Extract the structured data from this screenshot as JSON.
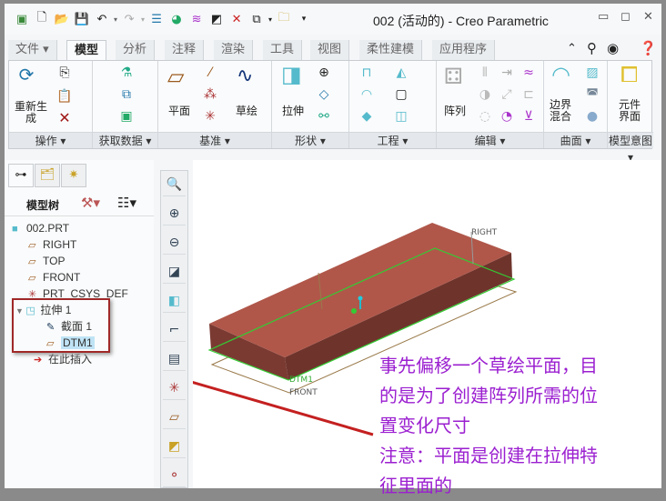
{
  "window": {
    "title": "002 (活动的) - Creo Parametric"
  },
  "quick_access": [
    "app-icon",
    "new-icon",
    "open-icon",
    "save-icon",
    "undo-icon",
    "redo-icon",
    "regenerate-icon",
    "shading-icon",
    "sketch-display-icon",
    "appearance-icon",
    "close-window-icon",
    "windows-icon",
    "folder-icon",
    "customize-icon"
  ],
  "tabs": [
    {
      "label": "文件 ▾"
    },
    {
      "label": "模型"
    },
    {
      "label": "分析"
    },
    {
      "label": "注释"
    },
    {
      "label": "渲染"
    },
    {
      "label": "工具"
    },
    {
      "label": "视图"
    },
    {
      "label": "柔性建模"
    },
    {
      "label": "应用程序"
    }
  ],
  "ribbon": {
    "groups": [
      {
        "label": "操作 ▾"
      },
      {
        "label": "获取数据 ▾"
      },
      {
        "label": "基准 ▾"
      },
      {
        "label": "形状 ▾"
      },
      {
        "label": "工程 ▾"
      },
      {
        "label": "编辑 ▾"
      },
      {
        "label": "曲面 ▾"
      },
      {
        "label": "模型意图 ▾"
      }
    ],
    "regenerate": "重新生成",
    "plane": "平面",
    "sketch": "草绘",
    "extrude": "拉伸",
    "pattern": "阵列",
    "boundary_blend": "边界混合",
    "component_interface": "元件界面"
  },
  "model_tree": {
    "title": "模型树",
    "items": [
      {
        "label": "002.PRT",
        "icon": "part-icon"
      },
      {
        "label": "RIGHT",
        "icon": "datum-plane-icon"
      },
      {
        "label": "TOP",
        "icon": "datum-plane-icon"
      },
      {
        "label": "FRONT",
        "icon": "datum-plane-icon"
      },
      {
        "label": "PRT_CSYS_DEF",
        "icon": "csys-icon"
      },
      {
        "label": "拉伸 1",
        "icon": "extrude-icon"
      },
      {
        "label": "截面 1",
        "icon": "sketch-icon"
      },
      {
        "label": "DTM1",
        "icon": "datum-plane-icon",
        "selected": true
      },
      {
        "label": "在此插入",
        "icon": "insert-arrow-icon"
      }
    ]
  },
  "view_toolbar": [
    "refit-icon",
    "zoom-in-icon",
    "zoom-out-icon",
    "repaint-icon",
    "display-style-icon",
    "saved-views-icon",
    "view-manager-icon",
    "spin-center-icon",
    "datum-planes-display-icon",
    "annotation-display-icon",
    "csys-display-icon"
  ],
  "graphics": {
    "labels": {
      "right": "RIGHT",
      "front": "FRONT",
      "dtm": "DTM1"
    }
  },
  "annotation": {
    "lines": [
      "事先偏移一个草绘平面，目",
      "的是为了创建阵列所需的位",
      "置变化尺寸",
      "注意：平面是创建在拉伸特",
      "征里面的"
    ],
    "color": "#9b1fd0"
  },
  "colors": {
    "model": "#b0574a",
    "highlight": "#cc2222",
    "selection": "#bfe3f5"
  }
}
